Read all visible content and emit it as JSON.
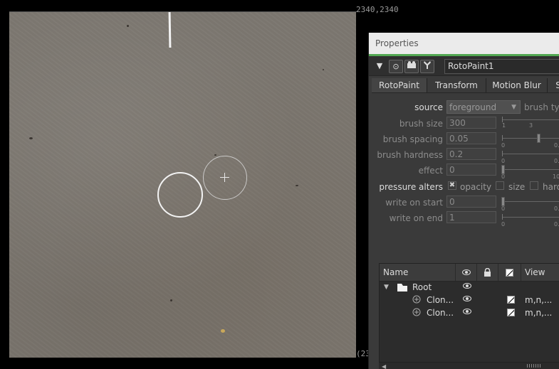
{
  "viewer": {
    "coord_top_right": "2340,2340",
    "coord_bottom_right": "(23"
  },
  "properties": {
    "title": "Properties",
    "node_name": "RotoPaint1",
    "tabs": [
      "RotoPaint",
      "Transform",
      "Motion Blur",
      "S"
    ],
    "source": {
      "label": "source",
      "value": "foreground",
      "brush_type_label": "brush typ"
    },
    "brush_size": {
      "label": "brush size",
      "value": "300",
      "tick_labels": [
        "1",
        "3"
      ]
    },
    "brush_spacing": {
      "label": "brush spacing",
      "value": "0.05",
      "tick_labels": [
        "0",
        "0."
      ]
    },
    "brush_hardness": {
      "label": "brush hardness",
      "value": "0.2",
      "tick_labels": [
        "0",
        "0."
      ]
    },
    "effect": {
      "label": "effect",
      "value": "0",
      "tick_labels": [
        "0",
        "10"
      ]
    },
    "pressure_alters": {
      "label": "pressure alters",
      "opacity": {
        "label": "opacity",
        "checked": true,
        "mark": "✖"
      },
      "size": {
        "label": "size",
        "checked": false
      },
      "hardness": {
        "label": "hard",
        "checked": false
      }
    },
    "write_on_start": {
      "label": "write on start",
      "value": "0",
      "tick_labels": [
        "0",
        "0."
      ]
    },
    "write_on_end": {
      "label": "write on end",
      "value": "1",
      "tick_labels": [
        "0",
        "0."
      ]
    }
  },
  "layers": {
    "headers": {
      "name": "Name",
      "view": "View"
    },
    "rows": [
      {
        "name": "Root",
        "view": ""
      },
      {
        "name": "Clon...",
        "view": "m,n,..."
      },
      {
        "name": "Clon...",
        "view": "m,n,..."
      }
    ]
  },
  "icons": {
    "collapse": "▼",
    "view": "⊙",
    "camera": "camera-icon",
    "tools": "tools-icon",
    "dropdown_arrow": "▼",
    "tree_expand": "▼",
    "scroll_left": "◀"
  },
  "colors": {
    "accent_green": "#52a752",
    "panel_bg": "#3a3a3a",
    "header_bg": "#ebebeb"
  }
}
